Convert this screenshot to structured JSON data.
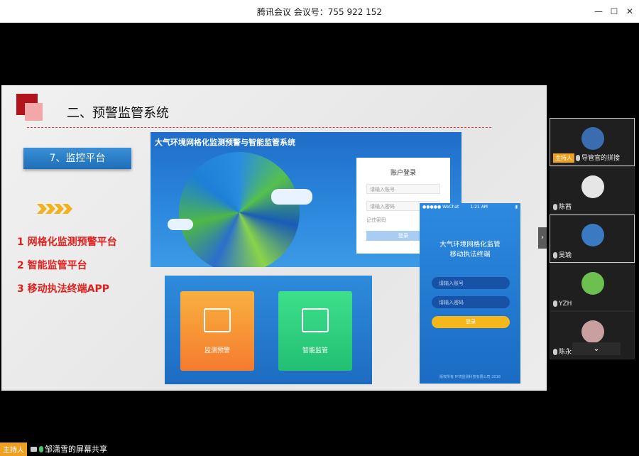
{
  "window": {
    "title": "腾讯会议 会议号：755 922 152",
    "controls": [
      "—",
      "☐",
      "✕"
    ]
  },
  "slide": {
    "title": "二、预警监管系统",
    "section_label": "7、监控平台",
    "list": [
      "1 网格化监测预警平台",
      "2 智能监管平台",
      "3 移动执法终端APP"
    ],
    "screenshot_main": {
      "system_title": "大气环境网格化监测预警与智能监管系统",
      "login_title": "账户登录",
      "login_user_placeholder": "请输入账号",
      "login_pass_placeholder": "请输入密码",
      "login_remember": "记住密码",
      "login_button": "登录"
    },
    "screenshot_low": {
      "tile_a_label": "监测预警",
      "tile_b_label": "智能监管"
    },
    "phone": {
      "status_left": "●●●●● WeChat",
      "status_time": "1:21 AM",
      "status_right": "▮",
      "title_line1": "大气环境网格化监管",
      "title_line2": "移动执法终端",
      "user_placeholder": "请输入账号",
      "pass_placeholder": "请输入密码",
      "login_button": "登录",
      "footer": "版权所有 环境监测科技有限公司 2018"
    }
  },
  "participants": [
    {
      "name": "导管官的拼接",
      "host": true,
      "host_label": "主持人",
      "avatar_color": "#3a6db0"
    },
    {
      "name": "陈茜",
      "host": false,
      "avatar_color": "#e6e6e6"
    },
    {
      "name": "吴瑜",
      "host": false,
      "avatar_color": "#3b79c2"
    },
    {
      "name": "YZH",
      "host": false,
      "avatar_color": "#6dbf4f"
    },
    {
      "name": "陈永清",
      "host": false,
      "avatar_color": "#c8a0a0"
    }
  ],
  "scroll_right": "›",
  "scroll_down": "⌄",
  "bottom_status": {
    "host_label": "主持人",
    "text": "邹潇雪的屏幕共享"
  }
}
